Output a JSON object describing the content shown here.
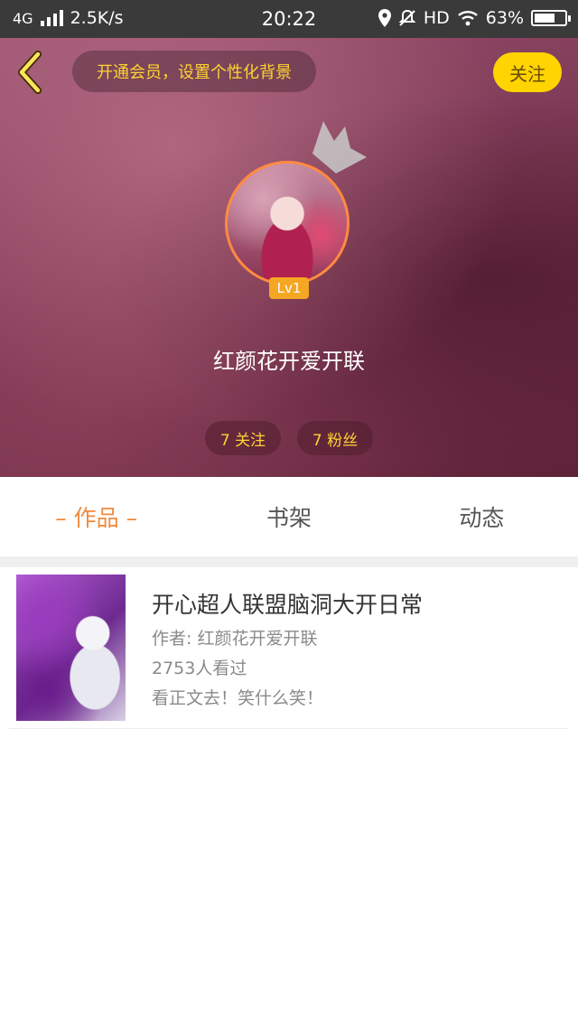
{
  "status_bar": {
    "network": "4G",
    "speed": "2.5K/s",
    "time": "20:22",
    "hd": "HD",
    "battery": "63%"
  },
  "header": {
    "vip_prompt": "开通会员，设置个性化背景",
    "follow_label": "关注",
    "level": "Lv1",
    "username": "红颜花开爱开联",
    "following": "7 关注",
    "fans": "7 粉丝"
  },
  "tabs": [
    {
      "label": "– 作品 –",
      "active": true
    },
    {
      "label": "书架",
      "active": false
    },
    {
      "label": "动态",
      "active": false
    }
  ],
  "works": [
    {
      "title": "开心超人联盟脑洞大开日常",
      "author": "作者: 红颜花开爱开联",
      "views": "2753人看过",
      "description": "看正文去！笑什么笑！"
    }
  ],
  "colors": {
    "accent_orange": "#f08a3e",
    "follow_yellow": "#ffd400",
    "status_bar": "#3a3a3a"
  }
}
